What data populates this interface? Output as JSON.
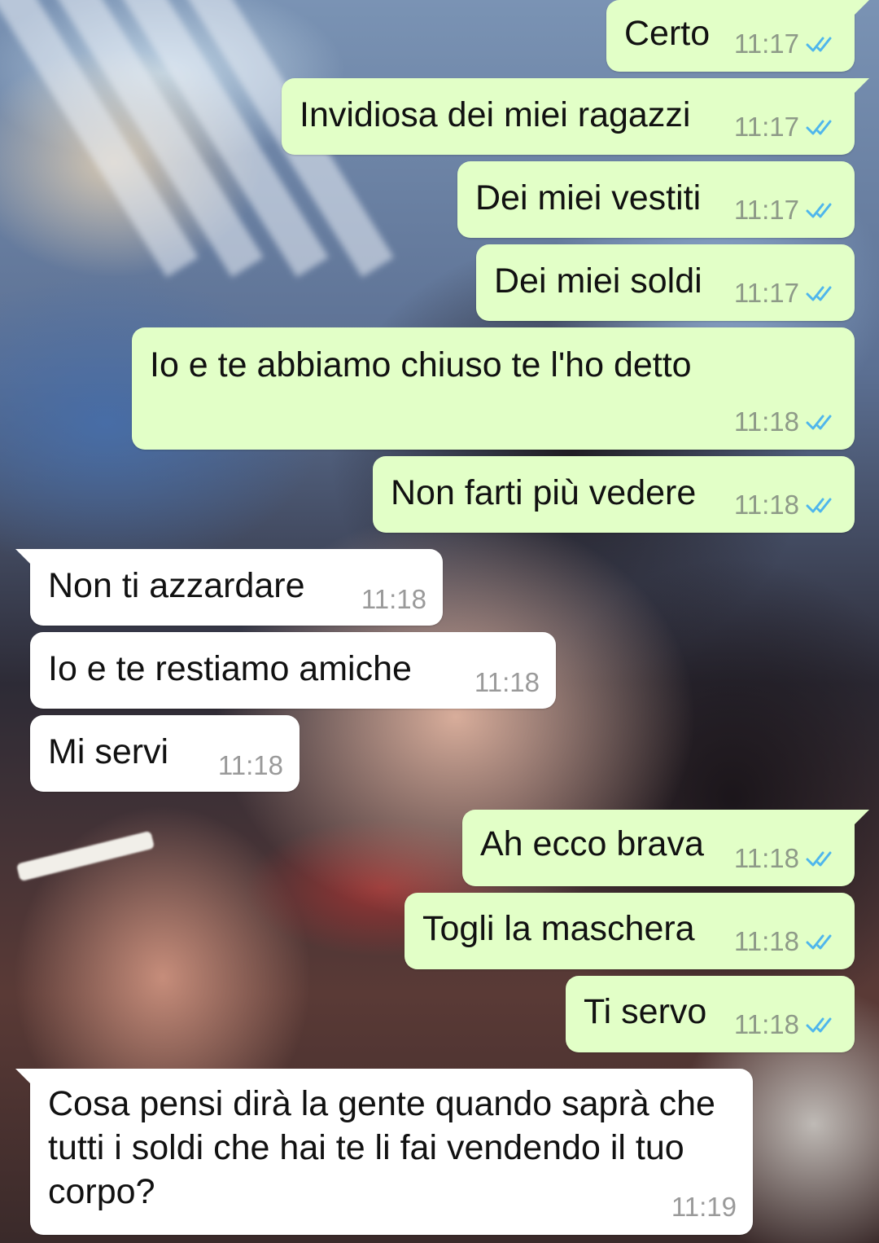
{
  "colors": {
    "outgoing_bubble": "#e2ffc7",
    "incoming_bubble": "#ffffff",
    "read_ticks": "#4fb6ec"
  },
  "read_receipt_icon": "double-check-icon",
  "messages": [
    {
      "direction": "out",
      "text": "Certo",
      "time": "11:17",
      "status": "read"
    },
    {
      "direction": "out",
      "text": "Invidiosa dei miei ragazzi",
      "time": "11:17",
      "status": "read"
    },
    {
      "direction": "out",
      "text": "Dei miei vestiti",
      "time": "11:17",
      "status": "read"
    },
    {
      "direction": "out",
      "text": "Dei miei soldi",
      "time": "11:17",
      "status": "read"
    },
    {
      "direction": "out",
      "text": "Io e te abbiamo chiuso te l'ho detto",
      "time": "11:18",
      "status": "read"
    },
    {
      "direction": "out",
      "text": "Non farti più vedere",
      "time": "11:18",
      "status": "read"
    },
    {
      "direction": "in",
      "text": "Non ti azzardare",
      "time": "11:18"
    },
    {
      "direction": "in",
      "text": "Io e te restiamo amiche",
      "time": "11:18"
    },
    {
      "direction": "in",
      "text": "Mi servi",
      "time": "11:18"
    },
    {
      "direction": "out",
      "text": "Ah ecco brava",
      "time": "11:18",
      "status": "read"
    },
    {
      "direction": "out",
      "text": "Togli la maschera",
      "time": "11:18",
      "status": "read"
    },
    {
      "direction": "out",
      "text": "Ti servo",
      "time": "11:18",
      "status": "read"
    },
    {
      "direction": "in",
      "text": "Cosa pensi dirà la gente quando saprà che tutti i soldi che hai te li fai vendendo il tuo corpo?",
      "time": "11:19"
    }
  ]
}
